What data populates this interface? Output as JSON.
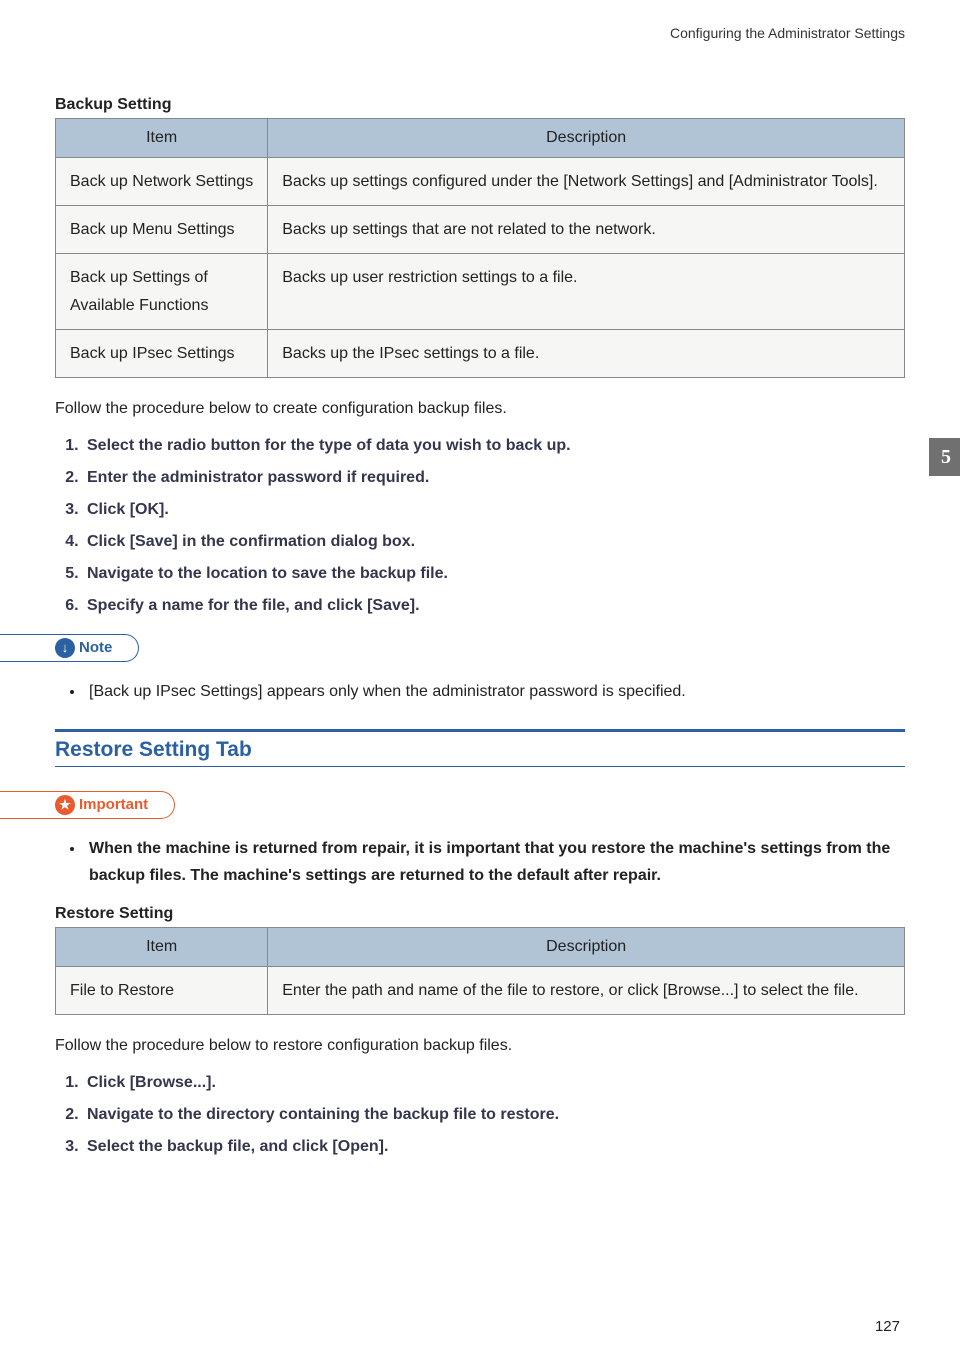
{
  "header": {
    "chapter_title": "Configuring the Administrator Settings"
  },
  "side_tab": "5",
  "page_number": "127",
  "backup_section": {
    "title": "Backup Setting",
    "columns": {
      "item": "Item",
      "description": "Description"
    },
    "rows": [
      {
        "item": "Back up Network Settings",
        "description": "Backs up settings configured under the [Network Settings] and [Administrator Tools]."
      },
      {
        "item": "Back up Menu Settings",
        "description": "Backs up settings that are not related to the network."
      },
      {
        "item": "Back up Settings of Available Functions",
        "description": "Backs up user restriction settings to a file."
      },
      {
        "item": "Back up IPsec Settings",
        "description": "Backs up the IPsec settings to a file."
      }
    ],
    "intro": "Follow the procedure below to create configuration backup files.",
    "steps": [
      "Select the radio button for the type of data you wish to back up.",
      "Enter the administrator password if required.",
      "Click [OK].",
      "Click [Save] in the confirmation dialog box.",
      "Navigate to the location to save the backup file.",
      "Specify a name for the file, and click [Save]."
    ],
    "note_label": "Note",
    "note_items": [
      "[Back up IPsec Settings] appears only when the administrator password is specified."
    ]
  },
  "restore_section": {
    "heading": "Restore Setting Tab",
    "important_label": "Important",
    "important_items": [
      "When the machine is returned from repair, it is important that you restore the machine's settings from the backup files. The machine's settings are returned to the default after repair."
    ],
    "title": "Restore Setting",
    "columns": {
      "item": "Item",
      "description": "Description"
    },
    "rows": [
      {
        "item": "File to Restore",
        "description": "Enter the path and name of the file to restore, or click [Browse...] to select the file."
      }
    ],
    "intro": "Follow the procedure below to restore configuration backup files.",
    "steps": [
      "Click [Browse...].",
      "Navigate to the directory containing the backup file to restore.",
      "Select the backup file, and click [Open]."
    ]
  }
}
